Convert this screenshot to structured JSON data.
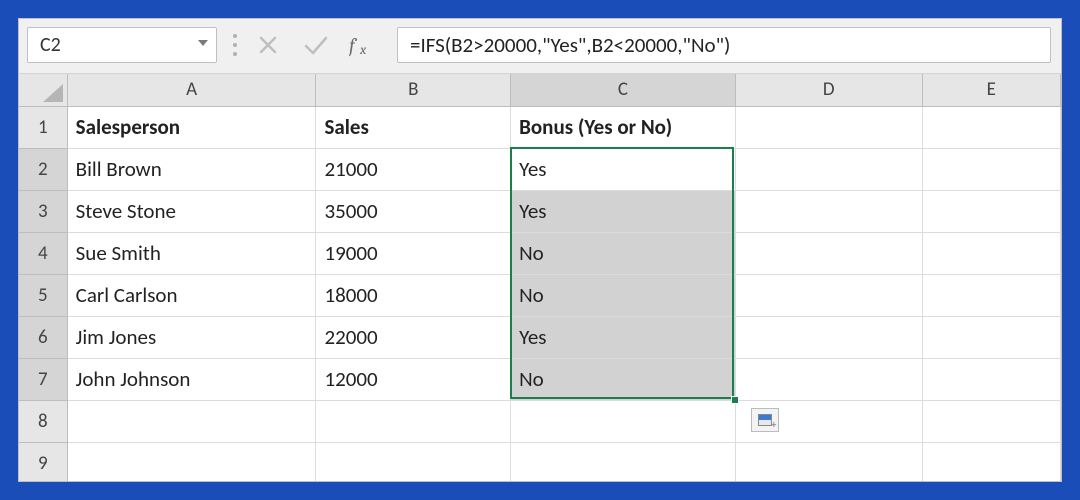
{
  "formula_bar": {
    "name_box": "C2",
    "formula": "=IFS(B2>20000,\"Yes\",B2<20000,\"No\")"
  },
  "columns": [
    "A",
    "B",
    "C",
    "D",
    "E"
  ],
  "row_numbers": [
    "1",
    "2",
    "3",
    "4",
    "5",
    "6",
    "7",
    "8",
    "9"
  ],
  "headers": {
    "A": "Salesperson",
    "B": "Sales",
    "C": "Bonus (Yes or No)"
  },
  "rows": [
    {
      "A": "Bill Brown",
      "B": "21000",
      "C": "Yes"
    },
    {
      "A": "Steve Stone",
      "B": "35000",
      "C": "Yes"
    },
    {
      "A": "Sue Smith",
      "B": "19000",
      "C": "No"
    },
    {
      "A": "Carl Carlson",
      "B": "18000",
      "C": "No"
    },
    {
      "A": "Jim Jones",
      "B": "22000",
      "C": "Yes"
    },
    {
      "A": "John Johnson",
      "B": "12000",
      "C": "No"
    }
  ],
  "selection": {
    "active_cell": "C2",
    "range": "C2:C7"
  }
}
